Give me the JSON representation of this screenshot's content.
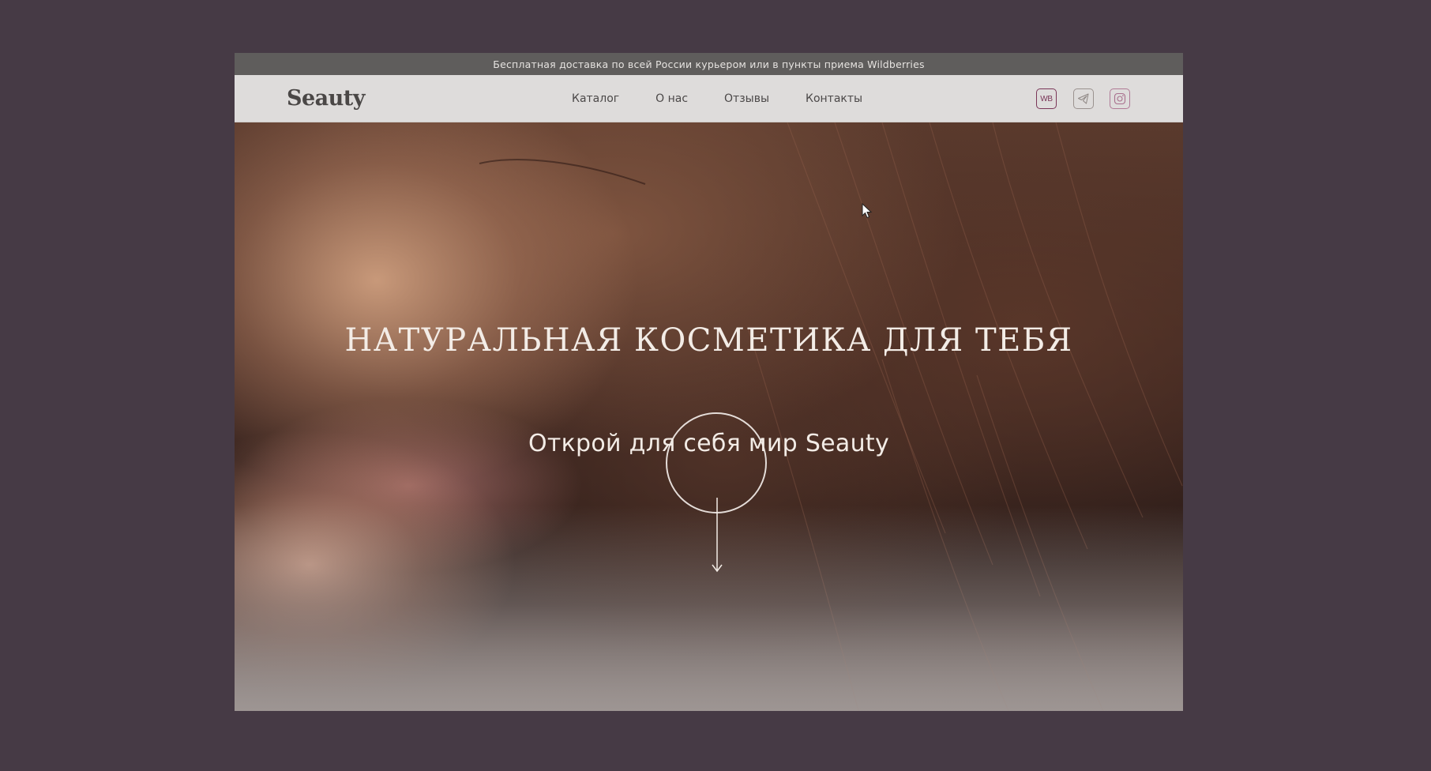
{
  "topbar": {
    "text": "Бесплатная доставка по всей России курьером или в пункты приема Wildberries"
  },
  "header": {
    "logo": "Seauty",
    "nav": [
      {
        "label": "Каталог"
      },
      {
        "label": "О нас"
      },
      {
        "label": "Отзывы"
      },
      {
        "label": "Контакты"
      }
    ],
    "social": {
      "wb_label": "WB",
      "icons": [
        "wildberries-icon",
        "telegram-icon",
        "instagram-icon"
      ]
    }
  },
  "hero": {
    "title": "НАТУРАЛЬНАЯ КОСМЕТИКА ДЛЯ ТЕБЯ",
    "subtitle": "Открой для себя мир Seauty"
  },
  "colors": {
    "page_background": "#463a45",
    "topbar_background": "#5f5d5c",
    "navbar_background": "#dedcdb",
    "accent_wb": "#7a3658",
    "hero_text": "#f3ece6"
  }
}
